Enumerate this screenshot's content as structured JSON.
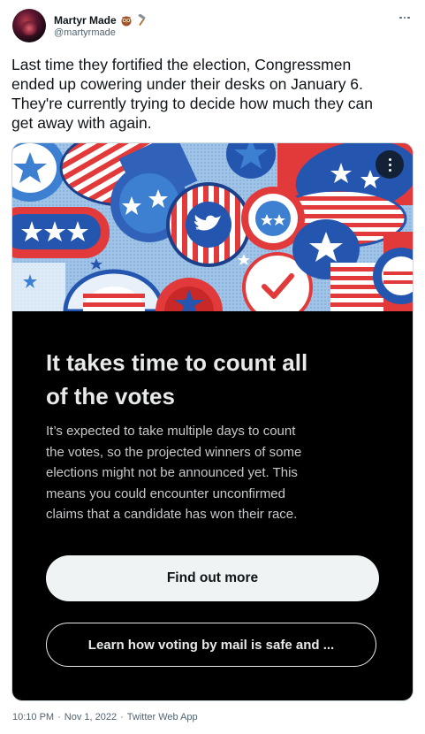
{
  "author": {
    "display_name": "Martyr Made",
    "handle": "@martyrmade",
    "emoji_icons": [
      "owl-emoji",
      "hammer-emoji"
    ]
  },
  "tweet": {
    "text": "Last time they fortified the election, Congressmen\nended up cowering under their desks on January 6.\nThey're currently trying to decide how much they can\nget away with again."
  },
  "card": {
    "title": "It takes time to count all\nof the votes",
    "body": "It’s expected to take multiple days to count\nthe votes, so the projected winners of some\nelections might not be announced yet. This\nmeans you could encounter unconfirmed\nclaims that a candidate has won their race.",
    "primary_button": "Find out more",
    "secondary_button": "Learn how voting by mail is safe and ..."
  },
  "meta": {
    "time": "10:10 PM",
    "separator": "·",
    "date": "Nov 1, 2022",
    "source": "Twitter Web App"
  },
  "colors": {
    "text_primary": "#0f1419",
    "text_secondary": "#536471",
    "card_bg": "#000000",
    "button_light": "#eff3f4"
  }
}
